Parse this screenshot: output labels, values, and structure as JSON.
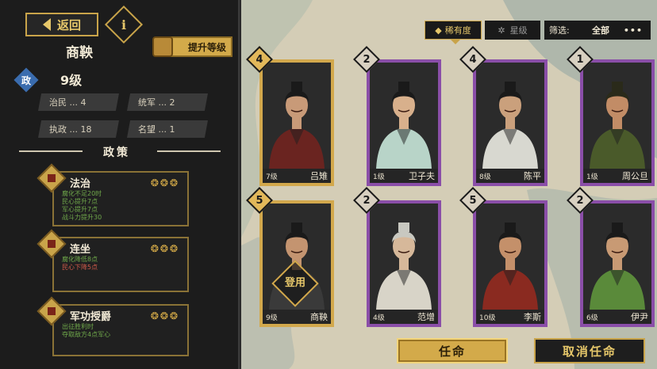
{
  "left": {
    "back_label": "返回",
    "info_label": "i",
    "upgrade_label": "提升等级",
    "name": "商鞅",
    "badge": "政",
    "level": "9级",
    "stats": {
      "zhimin": "治民 ... 4",
      "tongjun": "统军 ... 2",
      "zhizheng": "执政 ... 18",
      "mingwang": "名望 ... 1"
    },
    "policy_title": "政策",
    "policies": [
      {
        "name": "法治",
        "swirls": "❂❂❂",
        "lines": [
          {
            "t": "腐化不足20时",
            "c": "g"
          },
          {
            "t": "民心提升7点",
            "c": "g"
          },
          {
            "t": "军心提升7点",
            "c": "g"
          },
          {
            "t": "战斗力提升30",
            "c": "g"
          }
        ]
      },
      {
        "name": "连坐",
        "swirls": "❂❂❂",
        "lines": [
          {
            "t": "腐化降低8点",
            "c": "g"
          },
          {
            "t": "民心下降5点",
            "c": "r"
          }
        ]
      },
      {
        "name": "军功授爵",
        "swirls": "❂❂❂",
        "lines": [
          {
            "t": "出征胜利时",
            "c": "g"
          },
          {
            "t": "夺取敌方4点军心",
            "c": "g"
          }
        ]
      }
    ]
  },
  "toolbar": {
    "sort_rarity": "稀有度",
    "sort_star": "星级",
    "filter_label": "筛选:",
    "filter_value": "全部",
    "more": "•••"
  },
  "cards": [
    {
      "rank": "4",
      "level": "7级",
      "name": "吕雉",
      "frame": "gold"
    },
    {
      "rank": "2",
      "level": "1级",
      "name": "卫子夫",
      "frame": "purple"
    },
    {
      "rank": "4",
      "level": "8级",
      "name": "陈平",
      "frame": "purple"
    },
    {
      "rank": "1",
      "level": "1级",
      "name": "周公旦",
      "frame": "purple"
    },
    {
      "rank": "5",
      "level": "9级",
      "name": "商鞅",
      "frame": "gold",
      "appointed": "登用"
    },
    {
      "rank": "2",
      "level": "4级",
      "name": "范增",
      "frame": "purple"
    },
    {
      "rank": "5",
      "level": "10级",
      "name": "李斯",
      "frame": "purple"
    },
    {
      "rank": "2",
      "level": "6级",
      "name": "伊尹",
      "frame": "purple"
    }
  ],
  "buttons": {
    "appoint": "任命",
    "cancel": "取消任命"
  },
  "colors": {
    "gold": "#d2a84c",
    "purple": "#8a4ea8",
    "panel": "#1c1c1c",
    "map": "#d4cdb6"
  }
}
